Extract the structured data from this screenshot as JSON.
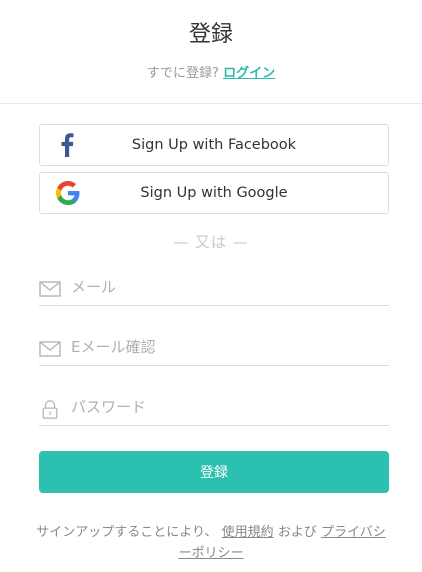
{
  "header": {
    "title": "登録",
    "already_text": "すでに登録?",
    "login_link": "ログイン"
  },
  "social": {
    "facebook_label": "Sign Up with Facebook",
    "google_label": "Sign Up with Google",
    "or_text": "— 又は —"
  },
  "form": {
    "email_placeholder": "メール",
    "email_confirm_placeholder": "Eメール確認",
    "password_placeholder": "パスワード",
    "submit_label": "登録"
  },
  "footer": {
    "terms_prefix": "サインアップすることにより、",
    "terms_link": "使用規約",
    "and_text": "および",
    "privacy_link": "プライバシーポリシー"
  },
  "colors": {
    "accent": "#2bc0b0",
    "link": "#2bbbad",
    "facebook": "#3b5998"
  },
  "icons": [
    "facebook-icon",
    "google-icon",
    "envelope-icon",
    "lock-icon"
  ]
}
